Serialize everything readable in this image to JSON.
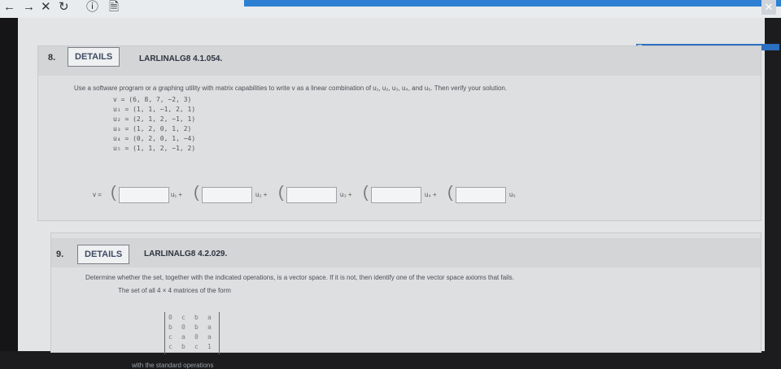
{
  "browser": {
    "nav_back": "←",
    "nav_forward": "→",
    "nav_close": "✕",
    "nav_reload": "↻",
    "nav_info": "ⓘ",
    "nav_page": "🗎",
    "window_close": "✕"
  },
  "q8": {
    "number": "8.",
    "details_label": "DETAILS",
    "code": "LARLINALG8 4.1.054.",
    "prompt": "Use a software program or a graphing utility with matrix capabilities to write v as a linear combination of u₁, u₂, u₃, u₄, and u₅. Then verify your solution.",
    "vectors": [
      "v = (6, 8, 7, −2, 3)",
      "u₁ = (1, 1, −1, 2, 1)",
      "u₂ = (2, 1, 2, −1, 1)",
      "u₃ = (1, 2, 0, 1, 2)",
      "u₄ = (0, 2, 0, 1, −4)",
      "u₅ = (1, 1, 2, −1, 2)"
    ],
    "answer_prefix": "v =",
    "answer_labels": [
      "u₁ +",
      "u₂ +",
      "u₃ +",
      "u₄ +",
      "u₅"
    ]
  },
  "q9": {
    "number": "9.",
    "details_label": "DETAILS",
    "code": "LARLINALG8 4.2.029.",
    "prompt": "Determine whether the set, together with the indicated operations, is a vector space. If it is not, then identify one of the vector space axioms that fails.",
    "set_text": "The set of all 4 × 4 matrices of the form",
    "matrix": [
      [
        "0",
        "c",
        "b",
        "a"
      ],
      [
        "b",
        "0",
        "b",
        "a"
      ],
      [
        "c",
        "a",
        "0",
        "a"
      ],
      [
        "c",
        "b",
        "c",
        "1"
      ]
    ],
    "operations_text": "with the standard operations"
  }
}
